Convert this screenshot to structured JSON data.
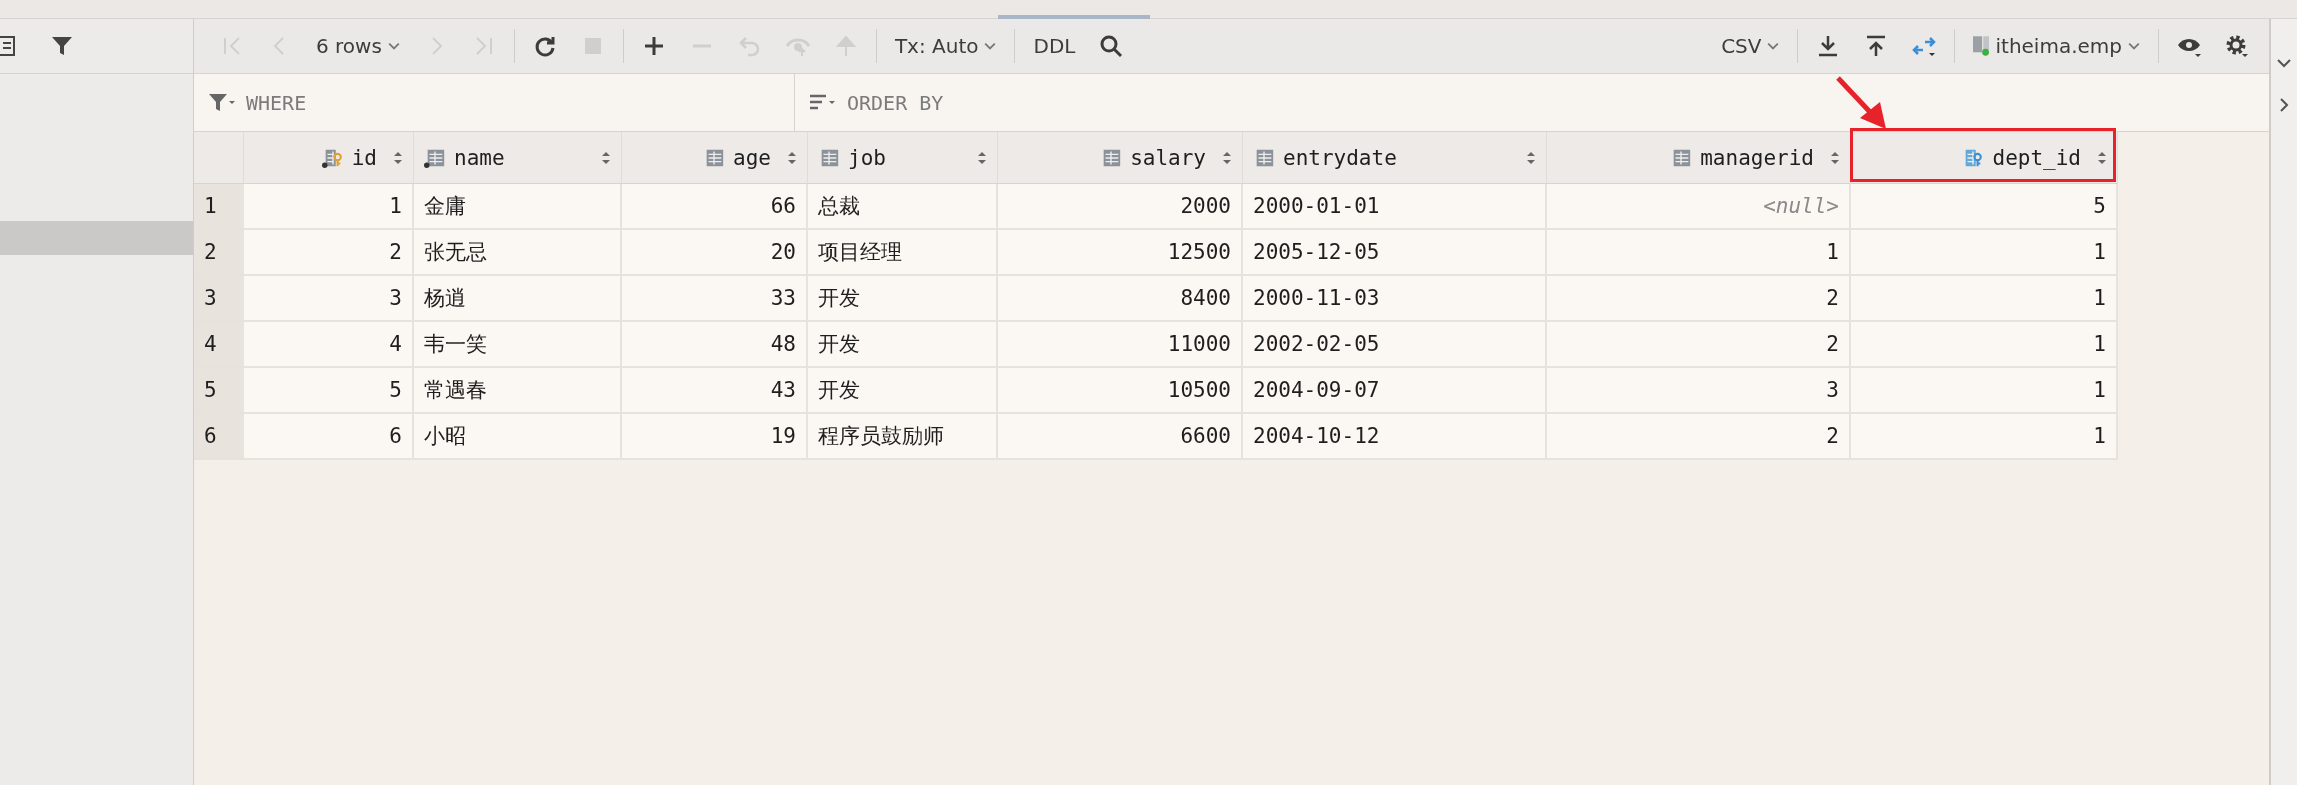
{
  "toolbar": {
    "buttons": [
      {
        "kind": "first",
        "disabled": true
      },
      {
        "kind": "prev",
        "disabled": true
      },
      {
        "kind": "rows",
        "label": "6 rows",
        "disabled": false
      },
      {
        "kind": "next",
        "disabled": true
      },
      {
        "kind": "last",
        "disabled": true
      },
      {
        "kind": "sep"
      },
      {
        "kind": "refresh",
        "disabled": false
      },
      {
        "kind": "stop",
        "disabled": true
      },
      {
        "kind": "sep"
      },
      {
        "kind": "add",
        "disabled": false
      },
      {
        "kind": "remove",
        "disabled": true
      },
      {
        "kind": "revert",
        "disabled": true
      },
      {
        "kind": "preview",
        "disabled": true
      },
      {
        "kind": "submit",
        "disabled": true
      },
      {
        "kind": "sep"
      },
      {
        "kind": "tx",
        "label": "Tx: Auto",
        "disabled": false
      },
      {
        "kind": "sep"
      },
      {
        "kind": "ddl",
        "label": "DDL",
        "disabled": false
      },
      {
        "kind": "search",
        "disabled": false
      },
      {
        "kind": "spacer"
      },
      {
        "kind": "csv",
        "label": "CSV",
        "disabled": false
      },
      {
        "kind": "sep"
      },
      {
        "kind": "download",
        "disabled": false
      },
      {
        "kind": "upload",
        "disabled": false
      },
      {
        "kind": "compare",
        "disabled": false
      },
      {
        "kind": "sep"
      },
      {
        "kind": "table",
        "label": "itheima.emp",
        "disabled": false
      },
      {
        "kind": "sep"
      },
      {
        "kind": "view",
        "disabled": false
      },
      {
        "kind": "settings",
        "disabled": false
      }
    ]
  },
  "filter": {
    "where_placeholder": "WHERE",
    "order_placeholder": "ORDER BY"
  },
  "table": {
    "columns": [
      {
        "name": "id",
        "kind": "primary-key",
        "not_null": true
      },
      {
        "name": "name",
        "kind": "column",
        "not_null": true
      },
      {
        "name": "age",
        "kind": "column",
        "not_null": false
      },
      {
        "name": "job",
        "kind": "column",
        "not_null": false
      },
      {
        "name": "salary",
        "kind": "column",
        "not_null": false
      },
      {
        "name": "entrydate",
        "kind": "column",
        "not_null": false
      },
      {
        "name": "managerid",
        "kind": "column",
        "not_null": false
      },
      {
        "name": "dept_id",
        "kind": "foreign-key",
        "not_null": false
      }
    ],
    "rows": [
      {
        "number": "1",
        "cells": [
          {
            "text": "1",
            "kind": "number"
          },
          {
            "text": "金庸",
            "kind": "text"
          },
          {
            "text": "66",
            "kind": "number"
          },
          {
            "text": "总裁",
            "kind": "text"
          },
          {
            "text": "2000",
            "kind": "number"
          },
          {
            "text": "2000-01-01",
            "kind": "text"
          },
          {
            "text": "<null>",
            "kind": "null"
          },
          {
            "text": "5",
            "kind": "number"
          }
        ]
      },
      {
        "number": "2",
        "cells": [
          {
            "text": "2",
            "kind": "number"
          },
          {
            "text": "张无忌",
            "kind": "text"
          },
          {
            "text": "20",
            "kind": "number"
          },
          {
            "text": "项目经理",
            "kind": "text"
          },
          {
            "text": "12500",
            "kind": "number"
          },
          {
            "text": "2005-12-05",
            "kind": "text"
          },
          {
            "text": "1",
            "kind": "number"
          },
          {
            "text": "1",
            "kind": "number"
          }
        ]
      },
      {
        "number": "3",
        "cells": [
          {
            "text": "3",
            "kind": "number"
          },
          {
            "text": "杨逍",
            "kind": "text"
          },
          {
            "text": "33",
            "kind": "number"
          },
          {
            "text": "开发",
            "kind": "text"
          },
          {
            "text": "8400",
            "kind": "number"
          },
          {
            "text": "2000-11-03",
            "kind": "text"
          },
          {
            "text": "2",
            "kind": "number"
          },
          {
            "text": "1",
            "kind": "number"
          }
        ]
      },
      {
        "number": "4",
        "cells": [
          {
            "text": "4",
            "kind": "number"
          },
          {
            "text": "韦一笑",
            "kind": "text"
          },
          {
            "text": "48",
            "kind": "number"
          },
          {
            "text": "开发",
            "kind": "text"
          },
          {
            "text": "11000",
            "kind": "number"
          },
          {
            "text": "2002-02-05",
            "kind": "text"
          },
          {
            "text": "2",
            "kind": "number"
          },
          {
            "text": "1",
            "kind": "number"
          }
        ]
      },
      {
        "number": "5",
        "cells": [
          {
            "text": "5",
            "kind": "number"
          },
          {
            "text": "常遇春",
            "kind": "text"
          },
          {
            "text": "43",
            "kind": "number"
          },
          {
            "text": "开发",
            "kind": "text"
          },
          {
            "text": "10500",
            "kind": "number"
          },
          {
            "text": "2004-09-07",
            "kind": "text"
          },
          {
            "text": "3",
            "kind": "number"
          },
          {
            "text": "1",
            "kind": "number"
          }
        ]
      },
      {
        "number": "6",
        "cells": [
          {
            "text": "6",
            "kind": "number"
          },
          {
            "text": "小昭",
            "kind": "text"
          },
          {
            "text": "19",
            "kind": "number"
          },
          {
            "text": "程序员鼓励师",
            "kind": "text"
          },
          {
            "text": "6600",
            "kind": "number"
          },
          {
            "text": "2004-10-12",
            "kind": "text"
          },
          {
            "text": "2",
            "kind": "number"
          },
          {
            "text": "1",
            "kind": "number"
          }
        ]
      }
    ]
  }
}
